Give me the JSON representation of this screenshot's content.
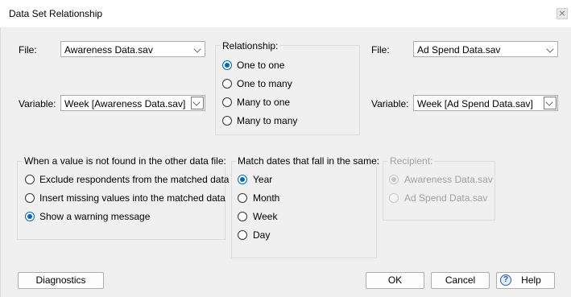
{
  "window": {
    "title": "Data Set Relationship"
  },
  "left_file": {
    "label": "File:",
    "value": "Awareness Data.sav",
    "variable_label": "Variable:",
    "variable_value": "Week [Awareness Data.sav]"
  },
  "right_file": {
    "label": "File:",
    "value": "Ad Spend Data.sav",
    "variable_label": "Variable:",
    "variable_value": "Week [Ad Spend Data.sav]"
  },
  "relationship": {
    "title": "Relationship:",
    "options": [
      "One to one",
      "One to many",
      "Many to one",
      "Many to many"
    ],
    "selected": "One to one"
  },
  "not_found": {
    "title": "When a value is not found in the other data file:",
    "options": [
      "Exclude respondents from the matched data",
      "Insert missing values into the matched data",
      "Show a warning message"
    ],
    "selected": "Show a warning message"
  },
  "match_dates": {
    "title": "Match dates that fall in the same:",
    "options": [
      "Year",
      "Month",
      "Week",
      "Day"
    ],
    "selected": "Year"
  },
  "recipient": {
    "title": "Recipient:",
    "options": [
      "Awareness Data.sav",
      "Ad Spend Data.sav"
    ],
    "selected": "Awareness Data.sav",
    "disabled": true
  },
  "buttons": {
    "diagnostics": "Diagnostics",
    "ok": "OK",
    "cancel": "Cancel",
    "help": "Help"
  },
  "colors": {
    "accent": "#0067c0",
    "background": "#f0f0f0"
  }
}
